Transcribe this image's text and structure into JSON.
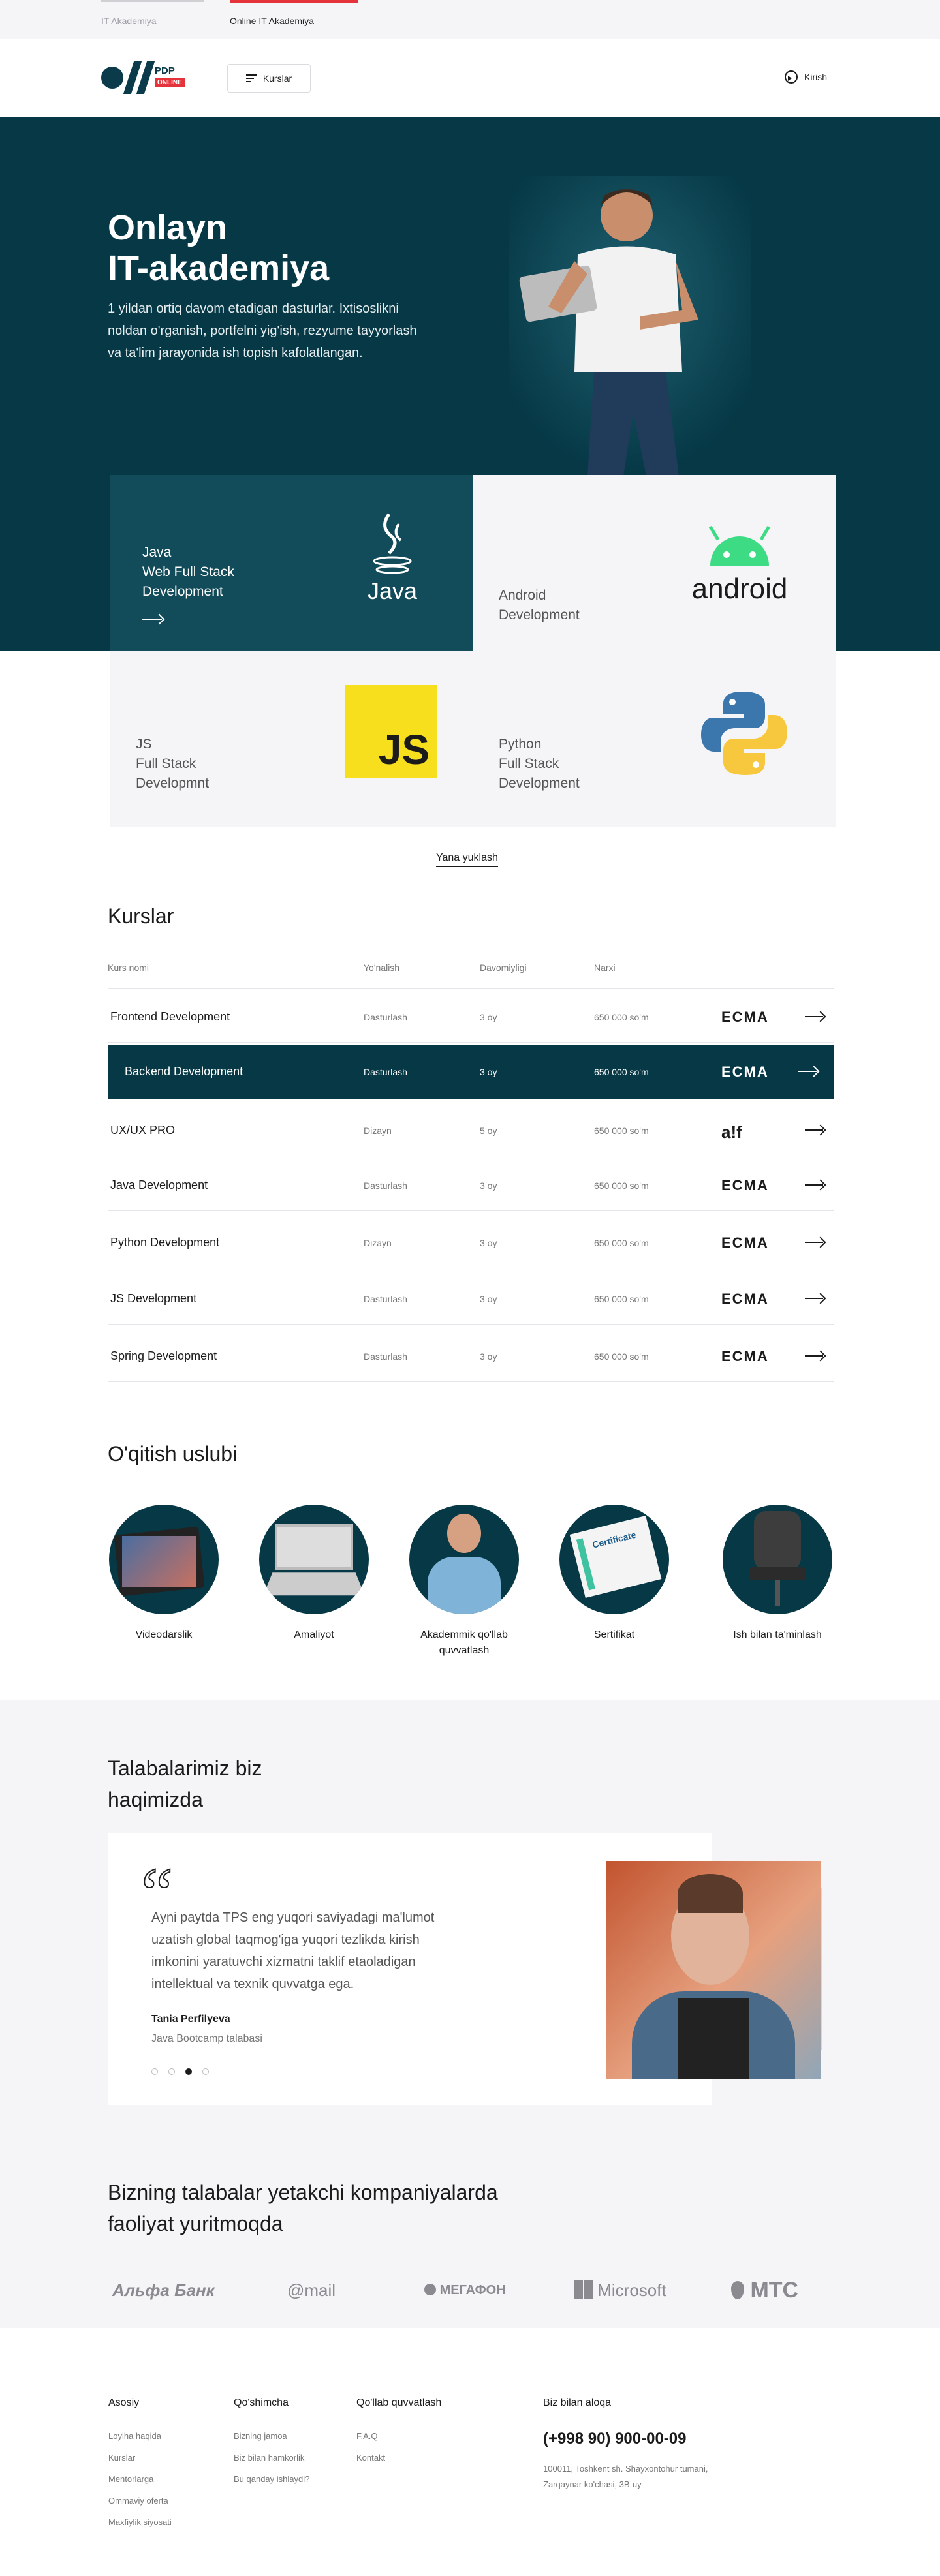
{
  "topbar": {
    "tab_1": "IT Akademiya",
    "tab_2": "Online IT Akademiya"
  },
  "header": {
    "logo_line1": "PDP",
    "logo_line2": "ONLINE",
    "menu_label": "Kurslar",
    "login_label": "Kirish"
  },
  "hero": {
    "title_line1": "Onlayn",
    "title_line2": "IT-akademiya",
    "description": "1 yildan ortiq davom etadigan dasturlar. Ixtisoslikni noldan o'rganish, portfelni yig'ish, rezyume tayyorlash va ta'lim jarayonida ish topish kafolatlangan."
  },
  "cards": {
    "java": {
      "line1": "Java",
      "line2": "Web Full Stack",
      "line3": "Development",
      "logo_text": "Java"
    },
    "android": {
      "line1": "Android",
      "line2": "Development",
      "logo_text": "android"
    },
    "js": {
      "line1": "JS",
      "line2": "Full Stack",
      "line3": "Developmnt",
      "logo_text": "JS"
    },
    "python": {
      "line1": "Python",
      "line2": "Full Stack",
      "line3": "Development"
    }
  },
  "more_button": "Yana yuklash",
  "courses": {
    "title": "Kurslar",
    "headers": {
      "name": "Kurs nomi",
      "direction": "Yo'nalish",
      "duration": "Davomiyligi",
      "price": "Narxi"
    },
    "rows": [
      {
        "name": "Frontend Development",
        "direction": "Dasturlash",
        "duration": "3 oy",
        "price": "650 000 so'm",
        "logo": "ECMA"
      },
      {
        "name": "Backend Development",
        "direction": "Dasturlash",
        "duration": "3 oy",
        "price": "650 000 so'm",
        "logo": "ECMA"
      },
      {
        "name": "UX/UX PRO",
        "direction": "Dizayn",
        "duration": "5 oy",
        "price": "650 000 so'm",
        "logo": "a!f"
      },
      {
        "name": "Java Development",
        "direction": "Dasturlash",
        "duration": "3 oy",
        "price": "650 000 so'm",
        "logo": "ECMA"
      },
      {
        "name": "Python Development",
        "direction": "Dizayn",
        "duration": "3 oy",
        "price": "650 000 so'm",
        "logo": "ECMA"
      },
      {
        "name": "JS Development",
        "direction": "Dasturlash",
        "duration": "3 oy",
        "price": "650 000 so'm",
        "logo": "ECMA"
      },
      {
        "name": "Spring Development",
        "direction": "Dasturlash",
        "duration": "3 oy",
        "price": "650 000 so'm",
        "logo": "ECMA"
      }
    ]
  },
  "teaching": {
    "title": "O'qitish uslubi",
    "items": [
      {
        "label": "Videodarslik"
      },
      {
        "label": "Amaliyot"
      },
      {
        "label": "Akademmik qo'llab quvvatlash"
      },
      {
        "label": "Sertifikat",
        "badge": "Certificate"
      },
      {
        "label": "Ish bilan ta'minlash"
      }
    ]
  },
  "testimonials": {
    "title_line1": "Talabalarimiz biz",
    "title_line2": "haqimizda",
    "text": "Ayni paytda TPS eng yuqori saviyadagi ma'lumot uzatish global taqmog'iga yuqori tezlikda kirish imkonini yaratuvchi xizmatni taklif etaoladigan intellektual va texnik quvvatga ega.",
    "name": "Tania Perfilyeva",
    "role": "Java Bootcamp talabasi"
  },
  "partners": {
    "title_line1": "Bizning talabalar yetakchi kompaniyalarda",
    "title_line2": "faoliyat yuritmoqda",
    "companies": [
      "Альфа Банк",
      "@mail",
      "МЕГАФОН",
      "Microsoft",
      "МТС"
    ]
  },
  "footer": {
    "col1": {
      "title": "Asosiy",
      "links": [
        "Loyiha haqida",
        "Kurslar",
        "Mentorlarga",
        "Ommaviy oferta",
        "Maxfiylik siyosati"
      ]
    },
    "col2": {
      "title": "Qo'shimcha",
      "links": [
        "Bizning jamoa",
        "Biz bilan hamkorlik",
        "Bu qanday ishlaydi?"
      ]
    },
    "col3": {
      "title": "Qo'llab quvvatlash",
      "links": [
        "F.A.Q",
        "Kontakt"
      ]
    },
    "contact": {
      "title": "Biz bilan aloqa",
      "phone": "(+998 90) 900-00-09",
      "address": "100011, Toshkent sh. Shayxontohur tumani, Zarqaynar ko'chasi, 3B-uy"
    }
  }
}
